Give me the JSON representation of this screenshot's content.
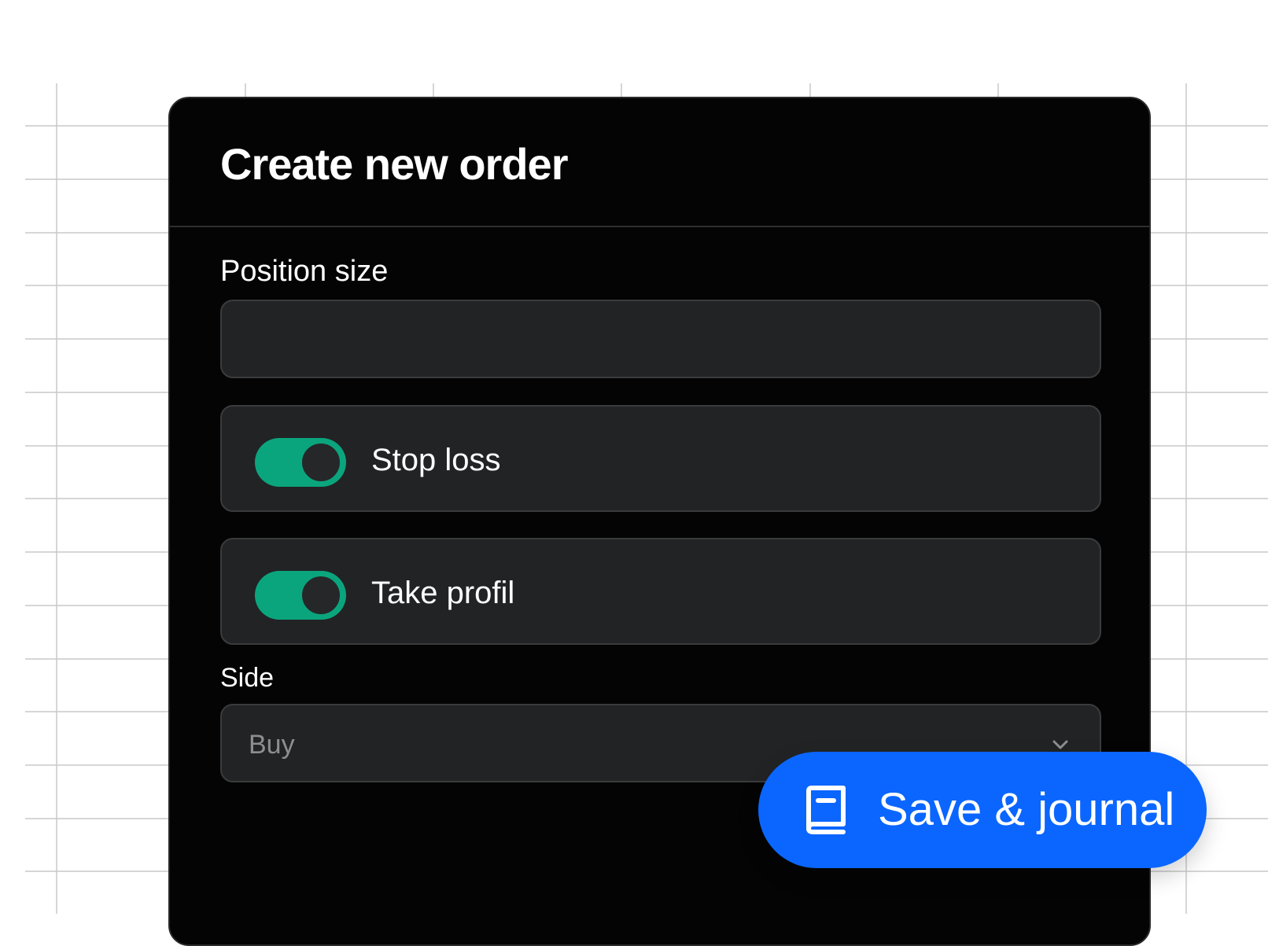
{
  "modal": {
    "title": "Create new order"
  },
  "position_size": {
    "label": "Position size",
    "value": ""
  },
  "stop_loss": {
    "label": "Stop loss",
    "enabled": true
  },
  "take_profit": {
    "label": "Take profil",
    "enabled": true
  },
  "side": {
    "label": "Side",
    "selected": "Buy"
  },
  "save_button": {
    "label": "Save & journal",
    "icon": "book-icon"
  },
  "colors": {
    "modal_bg": "#040404",
    "field_bg": "#222325",
    "toggle_on": "#0ba57d",
    "primary": "#0a66ff",
    "placeholder": "#8d8e90"
  }
}
